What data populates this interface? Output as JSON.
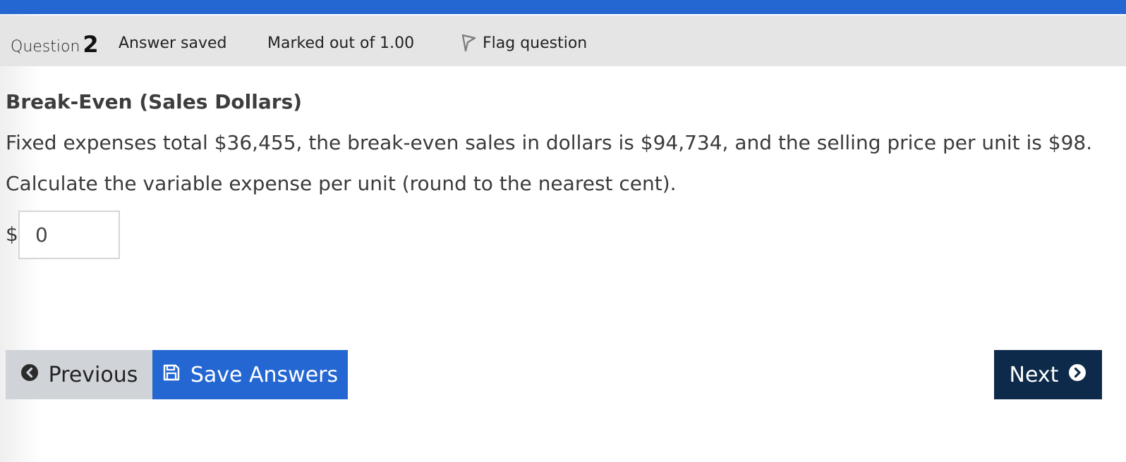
{
  "header": {
    "question_label": "Question",
    "question_number": "2",
    "status": "Answer saved",
    "marks": "Marked out of 1.00",
    "flag_label": "Flag question"
  },
  "question": {
    "title": "Break-Even (Sales Dollars)",
    "text_1": "Fixed expenses total $36,455, the break-even sales in dollars is $94,734, and the selling price per unit is $98.",
    "text_2": "Calculate the variable expense per unit (round to the nearest cent).",
    "currency_symbol": "$",
    "answer_value": "0"
  },
  "nav": {
    "previous_label": "Previous",
    "save_label": "Save Answers",
    "next_label": "Next"
  },
  "icons": {
    "flag": "flag-icon",
    "previous": "chevron-left-circle-icon",
    "save": "floppy-disk-icon",
    "next": "chevron-right-circle-icon"
  },
  "colors": {
    "top_bar": "#2467d2",
    "info_bar": "#e5e5e5",
    "save_button": "#2467d2",
    "previous_button": "#d0d4d9",
    "next_button": "#0e2a4a"
  }
}
